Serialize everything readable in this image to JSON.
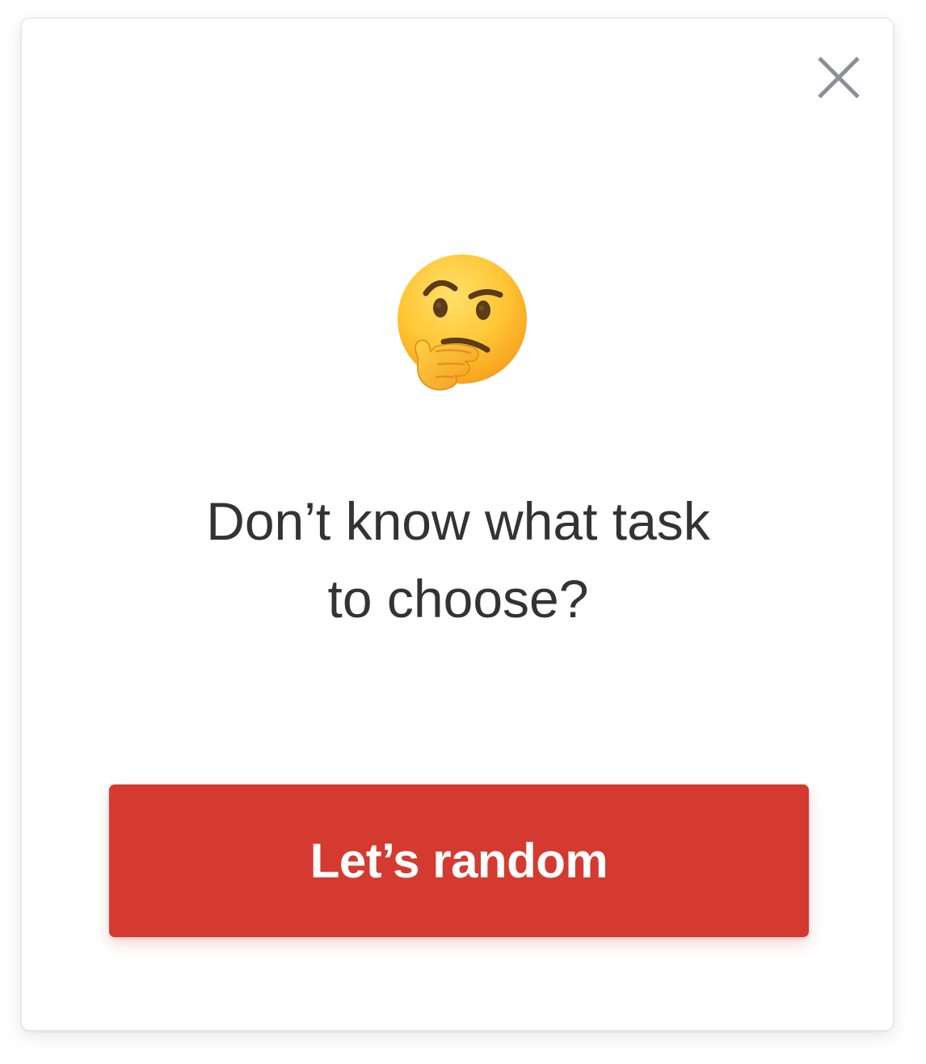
{
  "dialog": {
    "close_icon": "close-icon",
    "emoji_icon": "thinking-face-icon",
    "message_line1": "Don’t know what task",
    "message_line2": "to choose?",
    "action_label": "Let’s random"
  },
  "colors": {
    "accent": "#d43a30",
    "text": "#333333",
    "close_icon": "#8a9099",
    "background": "#ffffff"
  }
}
